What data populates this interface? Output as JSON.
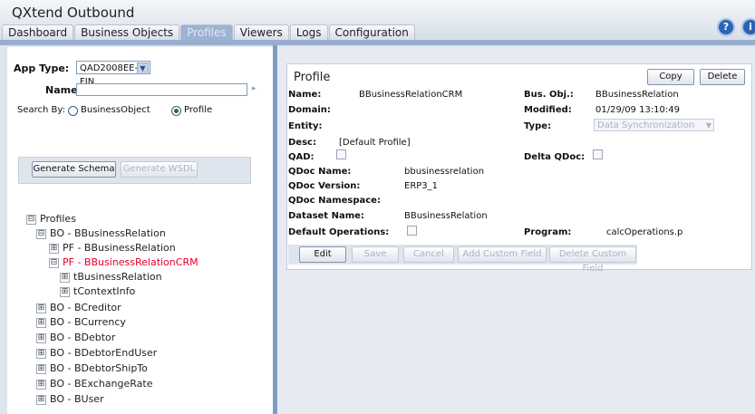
{
  "app": {
    "title": "QXtend Outbound"
  },
  "tabs": [
    {
      "label": "Dashboard",
      "active": false
    },
    {
      "label": "Business Objects",
      "active": false
    },
    {
      "label": "Profiles",
      "active": true
    },
    {
      "label": "Viewers",
      "active": false
    },
    {
      "label": "Logs",
      "active": false
    },
    {
      "label": "Configuration",
      "active": false
    }
  ],
  "header_icons": {
    "help": "?",
    "info": "i"
  },
  "search": {
    "app_type_label": "App Type:",
    "app_type_value": "QAD2008EE-FIN",
    "name_label": "Name:",
    "name_value": "",
    "search_by_label": "Search By:",
    "opt_bo": "BusinessObject",
    "opt_profile": "Profile",
    "selected": "Profile"
  },
  "schema": {
    "generate_schema": "Generate Schema",
    "generate_wsdl": "Generate WSDL"
  },
  "tree": [
    {
      "label": "Profiles",
      "toggle": "⊟",
      "level": 0
    },
    {
      "label": "BO - BBusinessRelation",
      "toggle": "⊟",
      "level": 1
    },
    {
      "label": "PF - BBusinessRelation",
      "toggle": "⊞",
      "level": 2
    },
    {
      "label": "PF - BBusinessRelationCRM",
      "toggle": "⊟",
      "level": 2,
      "selected": true
    },
    {
      "label": "tBusinessRelation",
      "toggle": "⊞",
      "level": 3
    },
    {
      "label": "tContextInfo",
      "toggle": "⊞",
      "level": 3
    },
    {
      "label": "BO - BCreditor",
      "toggle": "⊞",
      "level": 1
    },
    {
      "label": "BO - BCurrency",
      "toggle": "⊞",
      "level": 1
    },
    {
      "label": "BO - BDebtor",
      "toggle": "⊞",
      "level": 1
    },
    {
      "label": "BO - BDebtorEndUser",
      "toggle": "⊞",
      "level": 1
    },
    {
      "label": "BO - BDebtorShipTo",
      "toggle": "⊞",
      "level": 1
    },
    {
      "label": "BO - BExchangeRate",
      "toggle": "⊞",
      "level": 1
    },
    {
      "label": "BO - BUser",
      "toggle": "⊞",
      "level": 1
    }
  ],
  "profile": {
    "title": "Profile",
    "copy": "Copy",
    "delete": "Delete",
    "name_label": "Name:",
    "name_value": "BBusinessRelationCRM",
    "busobj_label": "Bus. Obj.:",
    "busobj_value": "BBusinessRelation",
    "domain_label": "Domain:",
    "modified_label": "Modified:",
    "modified_value": "01/29/09 13:10:49",
    "entity_label": "Entity:",
    "type_label": "Type:",
    "type_value": "Data Synchronization",
    "desc_label": "Desc:",
    "desc_value": "[Default Profile]",
    "qad_label": "QAD:",
    "delta_label": "Delta QDoc:",
    "qdocname_label": "QDoc Name:",
    "qdocname_value": "bbusinessrelation",
    "qdocversion_label": "QDoc Version:",
    "qdocversion_value": "ERP3_1",
    "qdocns_label": "QDoc Namespace:",
    "dataset_label": "Dataset Name:",
    "dataset_value": "BBusinessRelation",
    "defops_label": "Default Operations:",
    "program_label": "Program:",
    "program_value": "calcOperations.p"
  },
  "actions": {
    "edit": "Edit",
    "save": "Save",
    "cancel": "Cancel",
    "add_custom": "Add Custom Field",
    "delete_custom": "Delete Custom Field"
  }
}
